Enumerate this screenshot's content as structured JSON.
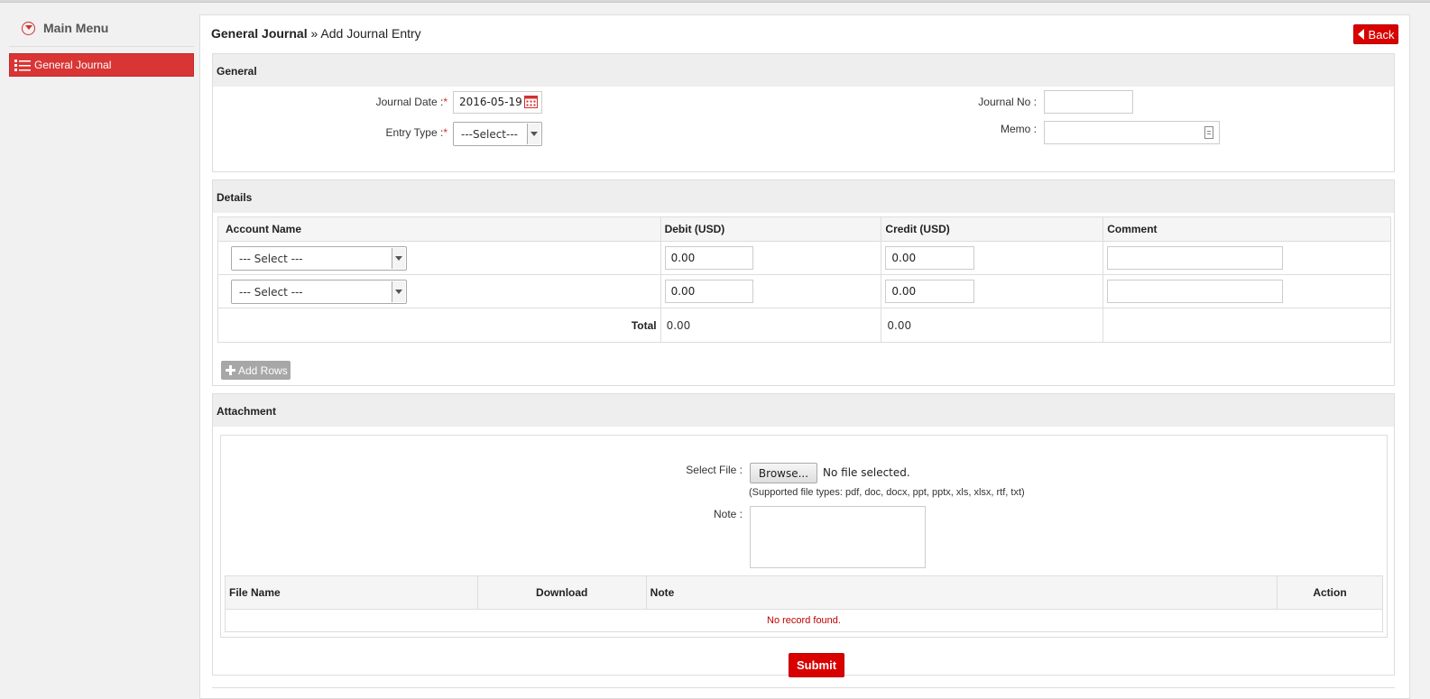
{
  "sidebar": {
    "title": "Main Menu",
    "items": [
      {
        "label": "General Journal"
      }
    ]
  },
  "breadcrumb": {
    "section": "General Journal",
    "sep": " » ",
    "page": "Add Journal Entry"
  },
  "back_label": "Back",
  "general": {
    "heading": "General",
    "journal_date_label": "Journal Date :",
    "journal_date_value": "2016-05-19",
    "entry_type_label": "Entry Type :",
    "entry_type_value": "---Select---",
    "journal_no_label": "Journal No :",
    "journal_no_value": "",
    "memo_label": "Memo :",
    "memo_value": "",
    "required_mark": "*"
  },
  "details": {
    "heading": "Details",
    "columns": [
      "Account Name",
      "Debit (USD)",
      "Credit (USD)",
      "Comment"
    ],
    "rows": [
      {
        "account": "--- Select ---",
        "debit": "0.00",
        "credit": "0.00",
        "comment": ""
      },
      {
        "account": "--- Select ---",
        "debit": "0.00",
        "credit": "0.00",
        "comment": ""
      }
    ],
    "total_label": "Total",
    "total_debit": "0.00",
    "total_credit": "0.00",
    "add_rows_label": "Add Rows"
  },
  "attachment": {
    "heading": "Attachment",
    "select_file_label": "Select File :",
    "browse_label": "Browse...",
    "no_file_text": "No file selected.",
    "supported_text": "(Supported file types: pdf, doc, docx, ppt, pptx, xls, xlsx, rtf, txt)",
    "note_label": "Note :",
    "note_value": "",
    "columns": [
      "File Name",
      "Download",
      "Note",
      "Action"
    ],
    "empty_text": "No record found."
  },
  "submit_label": "Submit",
  "colors": {
    "accent": "#d90000",
    "menu_active": "#d93535",
    "empty_text": "#c00000"
  }
}
